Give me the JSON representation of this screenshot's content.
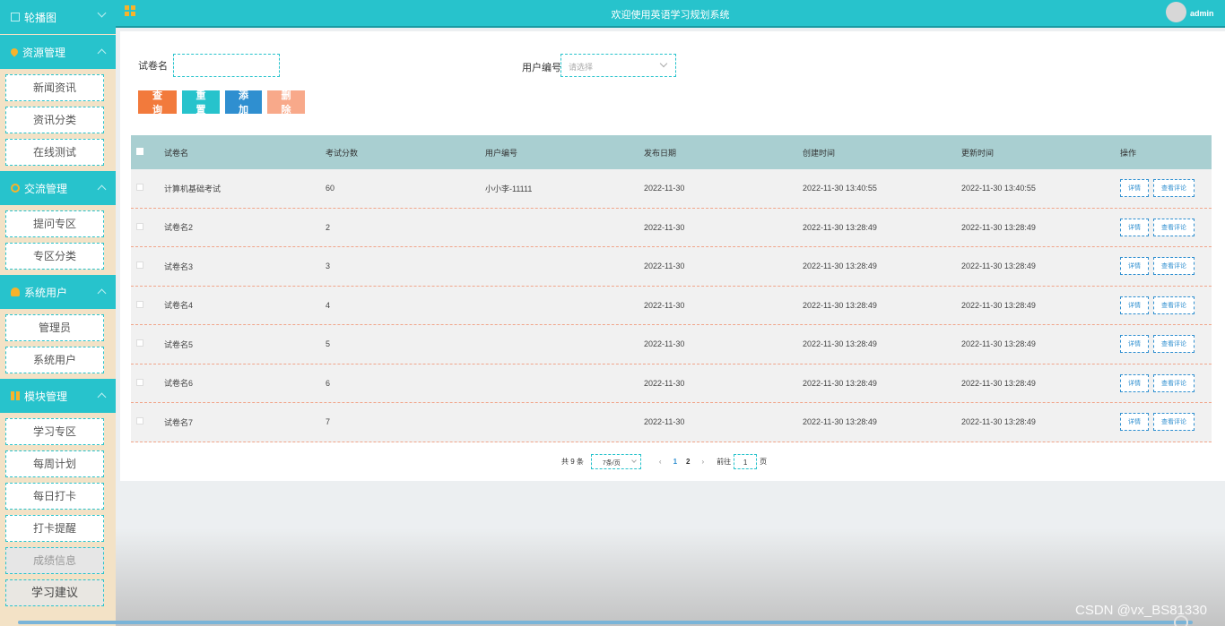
{
  "header": {
    "title": "欢迎使用英语学习规划系统",
    "user": "admin"
  },
  "sidebar": {
    "groups": [
      {
        "label": "轮播图",
        "items": []
      },
      {
        "label": "资源管理",
        "items": [
          "新闻资讯",
          "资讯分类",
          "在线测试"
        ]
      },
      {
        "label": "交流管理",
        "items": [
          "提问专区",
          "专区分类"
        ]
      },
      {
        "label": "系统用户",
        "items": [
          "管理员",
          "系统用户"
        ]
      },
      {
        "label": "模块管理",
        "items": [
          "学习专区",
          "每周计划",
          "每日打卡",
          "打卡提醒",
          "成绩信息",
          "学习建议"
        ]
      }
    ]
  },
  "search": {
    "name_label": "试卷名",
    "name_value": "",
    "user_label": "用户编号",
    "user_placeholder": "请选择"
  },
  "buttons": {
    "query": "查询",
    "reset": "重置",
    "add": "添加",
    "delete": "删除"
  },
  "table": {
    "headers": [
      "试卷名",
      "考试分数",
      "用户编号",
      "发布日期",
      "创建时间",
      "更新时间",
      "操作"
    ],
    "rows": [
      {
        "name": "计算机基础考试",
        "score": "60",
        "user": "小小李-11111",
        "date": "2022-11-30",
        "created": "2022-11-30 13:40:55",
        "updated": "2022-11-30 13:40:55"
      },
      {
        "name": "试卷名2",
        "score": "2",
        "user": "",
        "date": "2022-11-30",
        "created": "2022-11-30 13:28:49",
        "updated": "2022-11-30 13:28:49"
      },
      {
        "name": "试卷名3",
        "score": "3",
        "user": "",
        "date": "2022-11-30",
        "created": "2022-11-30 13:28:49",
        "updated": "2022-11-30 13:28:49"
      },
      {
        "name": "试卷名4",
        "score": "4",
        "user": "",
        "date": "2022-11-30",
        "created": "2022-11-30 13:28:49",
        "updated": "2022-11-30 13:28:49"
      },
      {
        "name": "试卷名5",
        "score": "5",
        "user": "",
        "date": "2022-11-30",
        "created": "2022-11-30 13:28:49",
        "updated": "2022-11-30 13:28:49"
      },
      {
        "name": "试卷名6",
        "score": "6",
        "user": "",
        "date": "2022-11-30",
        "created": "2022-11-30 13:28:49",
        "updated": "2022-11-30 13:28:49"
      },
      {
        "name": "试卷名7",
        "score": "7",
        "user": "",
        "date": "2022-11-30",
        "created": "2022-11-30 13:28:49",
        "updated": "2022-11-30 13:28:49"
      }
    ],
    "op_detail": "详情",
    "op_review": "查看评论"
  },
  "pager": {
    "total": "共 9 条",
    "page_size": "7条/页",
    "prev": "‹",
    "next": "›",
    "pages": [
      "1",
      "2"
    ],
    "goto_label": "前往",
    "goto_value": "1",
    "page_suffix": "页"
  },
  "watermark": "CSDN @vx_BS81330",
  "colors": {
    "accent": "#27c3cc",
    "query": "#f27a3c",
    "add": "#2f8fd0",
    "delete": "#f8a98a",
    "sidebar_bg": "#f3e2c6",
    "table_header": "#a9cfd1"
  }
}
